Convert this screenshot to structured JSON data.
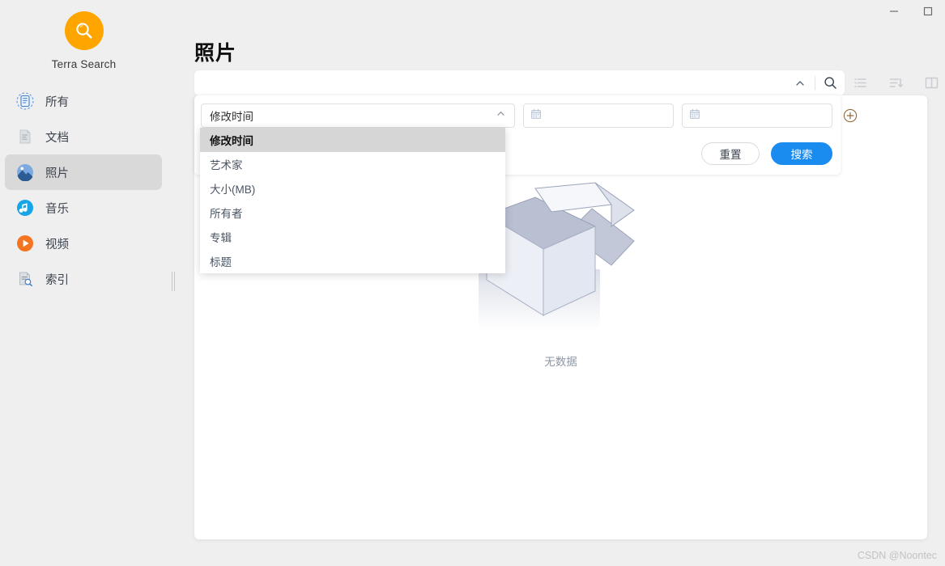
{
  "window": {
    "minimize_label": "—",
    "maximize_label": "□"
  },
  "sidebar": {
    "app_name": "Terra Search",
    "logo_icon": "search-logo-icon",
    "items": [
      {
        "label": "所有",
        "icon": "all-files-icon",
        "selected": false
      },
      {
        "label": "文档",
        "icon": "document-icon",
        "selected": false
      },
      {
        "label": "照片",
        "icon": "photo-icon",
        "selected": true
      },
      {
        "label": "音乐",
        "icon": "music-icon",
        "selected": false
      },
      {
        "label": "视频",
        "icon": "video-icon",
        "selected": false
      },
      {
        "label": "索引",
        "icon": "index-icon",
        "selected": false
      }
    ]
  },
  "header": {
    "title": "照片"
  },
  "search": {
    "value": "",
    "placeholder": "",
    "collapse_icon": "chevron-up-icon",
    "search_icon": "search-icon"
  },
  "toolbar": {
    "buttons": [
      {
        "name": "list-view-icon",
        "label": "列表视图"
      },
      {
        "name": "sort-icon",
        "label": "排序"
      },
      {
        "name": "split-pane-icon",
        "label": "分栏视图"
      }
    ]
  },
  "filter": {
    "field_select": {
      "selected": "修改时间",
      "chevron_icon": "chevron-up-icon",
      "options": [
        "修改时间",
        "艺术家",
        "大小(MB)",
        "所有者",
        "专辑",
        "标题"
      ],
      "active_index": 0
    },
    "date_from": {
      "value": "",
      "placeholder": "",
      "icon": "calendar-icon"
    },
    "date_to": {
      "value": "",
      "placeholder": "",
      "icon": "calendar-icon"
    },
    "add_condition_icon": "plus-circle-icon",
    "reset_label": "重置",
    "search_label": "搜索"
  },
  "content": {
    "empty_text": "无数据",
    "empty_illustration": "empty-box-icon"
  },
  "watermark": {
    "text": "CSDN @Noontec"
  },
  "colors": {
    "accent_blue": "#1a8cf0",
    "logo_orange": "#FFA500",
    "app_bg": "#efefef",
    "card_bg": "#ffffff",
    "selected_item_bg": "#d9d9d9",
    "dropdown_active_bg": "#d6d6d6"
  }
}
